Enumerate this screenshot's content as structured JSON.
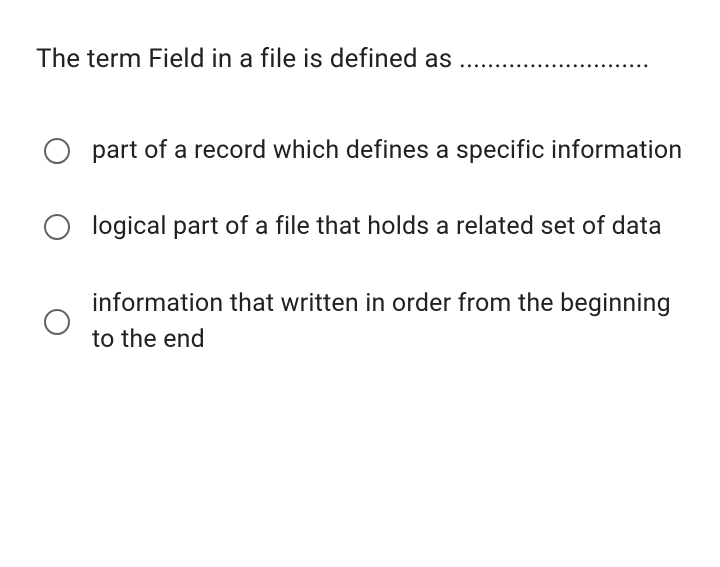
{
  "question": {
    "text": "The term Field in a file is defined as ..........................."
  },
  "options": [
    {
      "label": "part of a record which defines a specific information"
    },
    {
      "label": "logical part of a file that holds a related set of data"
    },
    {
      "label": "information that written in order from the beginning to the end"
    }
  ]
}
